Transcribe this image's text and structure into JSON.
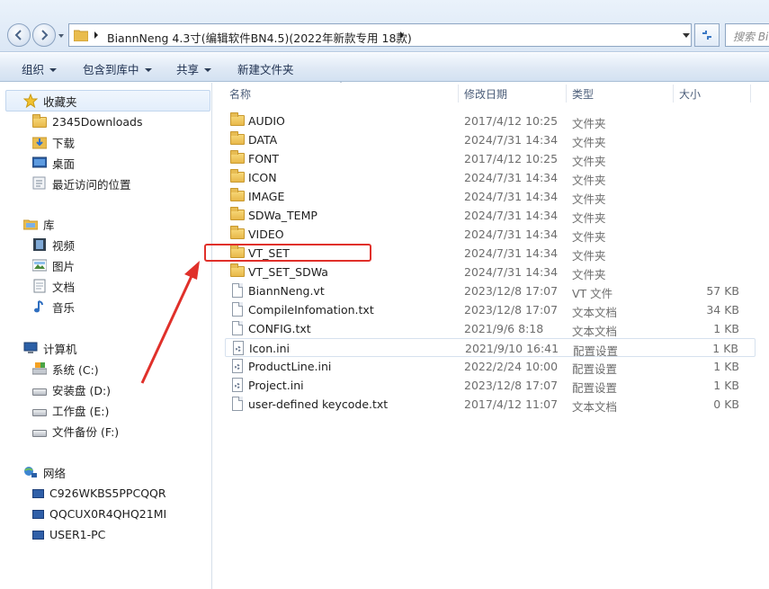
{
  "address": {
    "path": "BiannNeng 4.3寸(编辑软件BN4.5)(2022年新款专用 18款)",
    "search_placeholder": "搜索 Bi"
  },
  "toolbar": {
    "organize": "组织",
    "include_library": "包含到库中",
    "share": "共享",
    "new_folder": "新建文件夹"
  },
  "nav": {
    "favorites": "收藏夹",
    "fav_items": [
      "2345Downloads",
      "下载",
      "桌面",
      "最近访问的位置"
    ],
    "libraries": "库",
    "lib_items": [
      "视频",
      "图片",
      "文档",
      "音乐"
    ],
    "computer": "计算机",
    "drives": [
      "系统 (C:)",
      "安装盘 (D:)",
      "工作盘 (E:)",
      "文件备份 (F:)"
    ],
    "network": "网络",
    "net_items": [
      "C926WKBS5PPCQQR",
      "QQCUX0R4QHQ21MI",
      "USER1-PC"
    ]
  },
  "columns": {
    "name": "名称",
    "date": "修改日期",
    "type": "类型",
    "size": "大小"
  },
  "files": [
    {
      "name": "AUDIO",
      "date": "2017/4/12 10:25",
      "type": "文件夹",
      "size": "",
      "icon": "folder-icon"
    },
    {
      "name": "DATA",
      "date": "2024/7/31 14:34",
      "type": "文件夹",
      "size": "",
      "icon": "folder-icon"
    },
    {
      "name": "FONT",
      "date": "2017/4/12 10:25",
      "type": "文件夹",
      "size": "",
      "icon": "folder-icon"
    },
    {
      "name": "ICON",
      "date": "2024/7/31 14:34",
      "type": "文件夹",
      "size": "",
      "icon": "folder-icon"
    },
    {
      "name": "IMAGE",
      "date": "2024/7/31 14:34",
      "type": "文件夹",
      "size": "",
      "icon": "folder-icon"
    },
    {
      "name": "SDWa_TEMP",
      "date": "2024/7/31 14:34",
      "type": "文件夹",
      "size": "",
      "icon": "folder-icon"
    },
    {
      "name": "VIDEO",
      "date": "2024/7/31 14:34",
      "type": "文件夹",
      "size": "",
      "icon": "folder-icon"
    },
    {
      "name": "VT_SET",
      "date": "2024/7/31 14:34",
      "type": "文件夹",
      "size": "",
      "icon": "folder-icon"
    },
    {
      "name": "VT_SET_SDWa",
      "date": "2024/7/31 14:34",
      "type": "文件夹",
      "size": "",
      "icon": "folder-icon"
    },
    {
      "name": "BiannNeng.vt",
      "date": "2023/12/8 17:07",
      "type": "VT 文件",
      "size": "57 KB",
      "icon": "file-icon"
    },
    {
      "name": "CompileInfomation.txt",
      "date": "2023/12/8 17:07",
      "type": "文本文档",
      "size": "34 KB",
      "icon": "file-icon"
    },
    {
      "name": "CONFIG.txt",
      "date": "2021/9/6 8:18",
      "type": "文本文档",
      "size": "1 KB",
      "icon": "file-icon"
    },
    {
      "name": "Icon.ini",
      "date": "2021/9/10 16:41",
      "type": "配置设置",
      "size": "1 KB",
      "icon": "ini-icon"
    },
    {
      "name": "ProductLine.ini",
      "date": "2022/2/24 10:00",
      "type": "配置设置",
      "size": "1 KB",
      "icon": "ini-icon"
    },
    {
      "name": "Project.ini",
      "date": "2023/12/8 17:07",
      "type": "配置设置",
      "size": "1 KB",
      "icon": "ini-icon"
    },
    {
      "name": "user-defined keycode.txt",
      "date": "2017/4/12 11:07",
      "type": "文本文档",
      "size": "0 KB",
      "icon": "file-icon"
    }
  ],
  "colors": {
    "annotation_red": "#e0302a"
  }
}
